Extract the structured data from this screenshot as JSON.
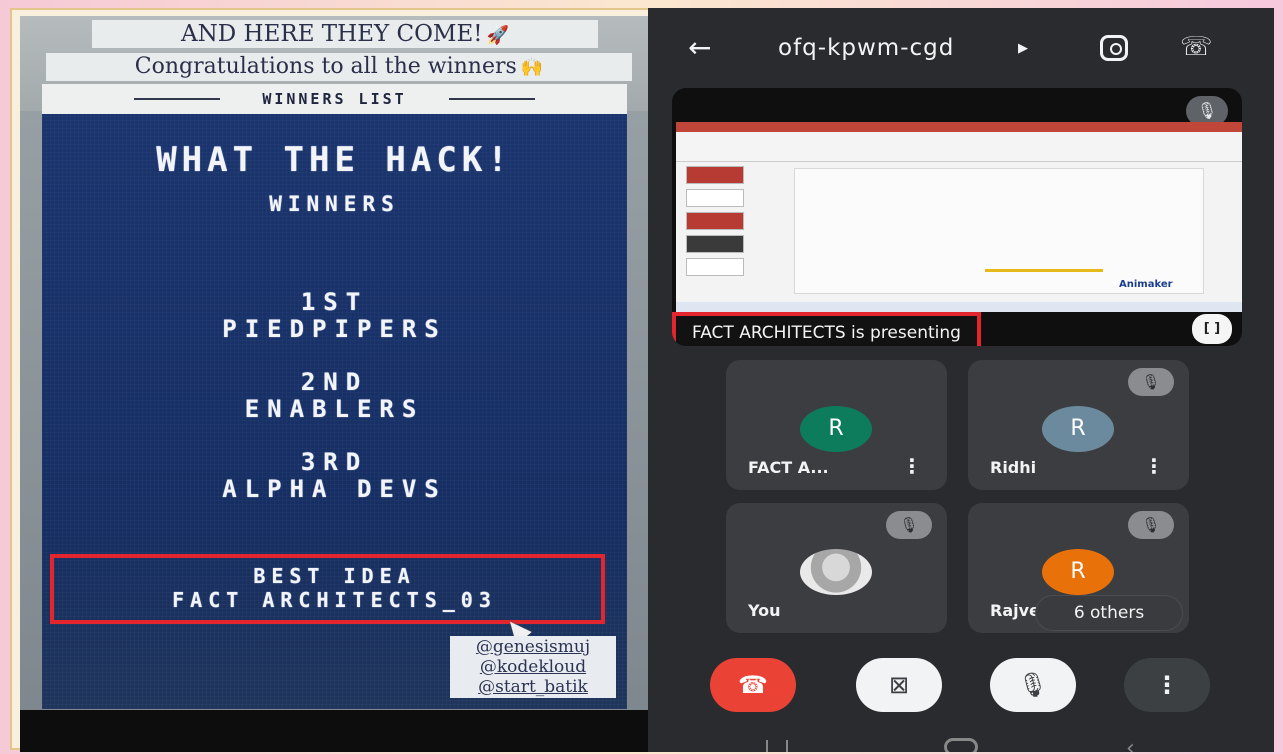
{
  "story": {
    "caption_1": "AND HERE THEY COME!",
    "caption_1_emoji": "🚀",
    "caption_2": "Congratulations to all the winners",
    "caption_2_emoji": "🙌",
    "list_header": "WINNERS LIST",
    "title": "WHAT THE HACK!",
    "subtitle": "WINNERS",
    "places": [
      {
        "rank": "1ST",
        "team": "PIEDPIPERS"
      },
      {
        "rank": "2ND",
        "team": "ENABLERS"
      },
      {
        "rank": "3RD",
        "team": "ALPHA DEVS"
      }
    ],
    "best_idea_label": "BEST IDEA",
    "best_idea_team": "FACT ARCHITECTS_03",
    "handles": [
      "@genesismuj",
      "@kodekloud",
      "@start_batik"
    ]
  },
  "meet": {
    "code": "ofq-kpwm-cgd",
    "presenting_text": "FACT ARCHITECTS is presenting",
    "slide_brand": "Animaker",
    "participants": [
      {
        "initial": "R",
        "name": "FACT A...",
        "color": "#0d7c5d"
      },
      {
        "initial": "R",
        "name": "Ridhi",
        "color": "#6c8a9e"
      },
      {
        "initial": "",
        "name": "You",
        "color": ""
      },
      {
        "initial": "R",
        "name": "Rajvee",
        "color": "#e8710a"
      }
    ],
    "others_label": "6 others"
  }
}
